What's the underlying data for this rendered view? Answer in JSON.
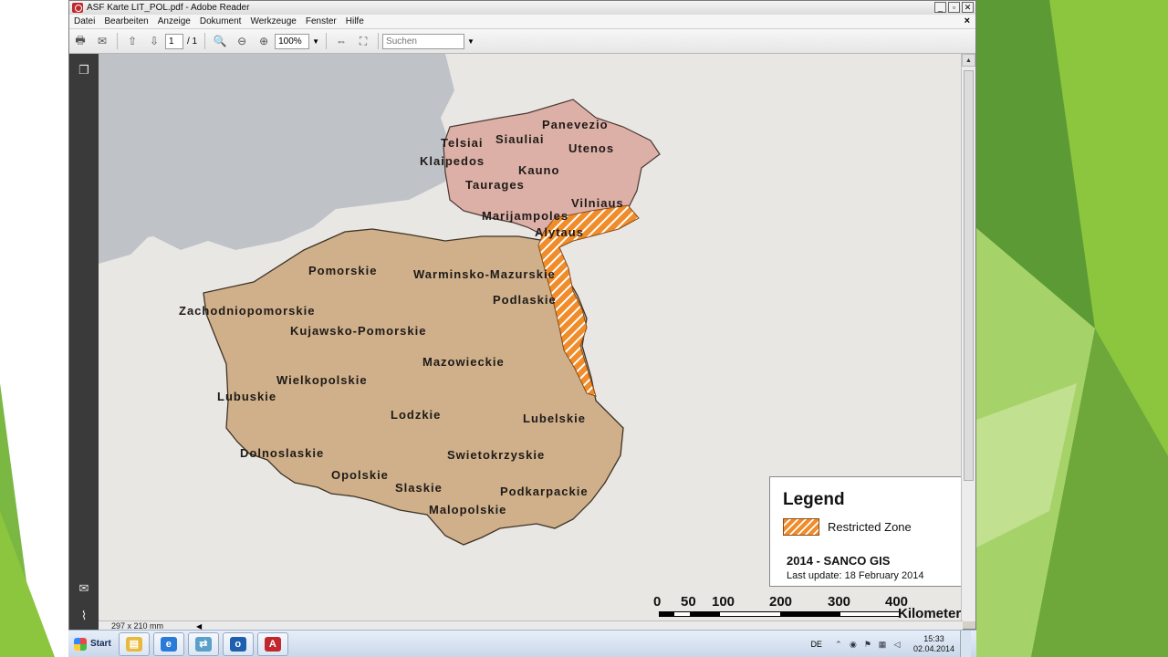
{
  "window": {
    "title": "ASF Karte LIT_POL.pdf - Adobe Reader",
    "controls": {
      "minimize": "_",
      "restore": "▫",
      "close": "✕"
    }
  },
  "menu": {
    "items": [
      "Datei",
      "Bearbeiten",
      "Anzeige",
      "Dokument",
      "Werkzeuge",
      "Fenster",
      "Hilfe"
    ],
    "close_doc": "×"
  },
  "toolbar": {
    "page_current": "1",
    "page_total": "/ 1",
    "zoom": "100%",
    "search_placeholder": "Suchen"
  },
  "status": {
    "page_size": "297 x 210 mm"
  },
  "map": {
    "lithuania_regions": [
      "Panevezio",
      "Telsiai",
      "Siauliai",
      "Utenos",
      "Klaipedos",
      "Kauno",
      "Taurages",
      "Vilniaus",
      "Marijampoles",
      "Alytaus"
    ],
    "poland_regions": [
      "Pomorskie",
      "Warminsko-Mazurskie",
      "Zachodniopomorskie",
      "Podlaskie",
      "Kujawsko-Pomorskie",
      "Mazowieckie",
      "Wielkopolskie",
      "Lubuskie",
      "Lodzkie",
      "Lubelskie",
      "Dolnoslaskie",
      "Swietokrzyskie",
      "Opolskie",
      "Slaskie",
      "Podkarpackie",
      "Malopolskie"
    ],
    "colors": {
      "lithuania": "#dcb0a6",
      "poland": "#cfb08a",
      "restricted": "#f08c2a",
      "background": "#e9e7e4",
      "sea": "#bfc3c8"
    }
  },
  "legend": {
    "title": "Legend",
    "item_label": "Restricted Zone",
    "source": "2014 - SANCO GIS",
    "update": "Last update: 18 February 2014"
  },
  "scale": {
    "labels": [
      "0",
      "50",
      "100",
      "200",
      "300",
      "400"
    ],
    "unit": "Kilometers"
  },
  "taskbar": {
    "start_label": "Start",
    "language": "DE",
    "time": "15:33",
    "date": "02.04.2014"
  }
}
